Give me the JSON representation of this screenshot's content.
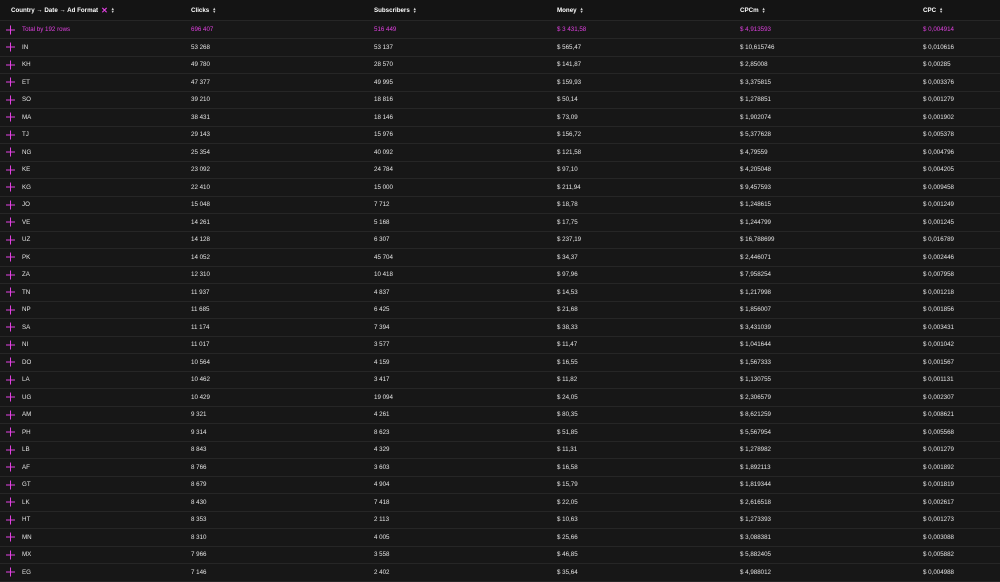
{
  "header": {
    "group_label": "Country → Date → Ad Format",
    "columns": [
      "Clicks",
      "Subscribers",
      "Money",
      "CPCm",
      "CPC"
    ]
  },
  "total": {
    "label": "Total by 192 rows",
    "clicks": "696 407",
    "subscribers": "516 449",
    "money": "$ 3 431,58",
    "cpcm": "$ 4,913593",
    "cpc": "$ 0,004914"
  },
  "rows": [
    [
      "IN",
      "53 268",
      "53 137",
      "$ 565,47",
      "$ 10,615746",
      "$ 0,010616"
    ],
    [
      "KH",
      "49 780",
      "28 570",
      "$ 141,87",
      "$ 2,85008",
      "$ 0,00285"
    ],
    [
      "ET",
      "47 377",
      "49 995",
      "$ 159,93",
      "$ 3,375815",
      "$ 0,003376"
    ],
    [
      "SO",
      "39 210",
      "18 816",
      "$ 50,14",
      "$ 1,278851",
      "$ 0,001279"
    ],
    [
      "MA",
      "38 431",
      "18 146",
      "$ 73,09",
      "$ 1,902074",
      "$ 0,001902"
    ],
    [
      "TJ",
      "29 143",
      "15 976",
      "$ 156,72",
      "$ 5,377628",
      "$ 0,005378"
    ],
    [
      "NG",
      "25 354",
      "40 092",
      "$ 121,58",
      "$ 4,79559",
      "$ 0,004796"
    ],
    [
      "KE",
      "23 092",
      "24 784",
      "$ 97,10",
      "$ 4,205048",
      "$ 0,004205"
    ],
    [
      "KG",
      "22 410",
      "15 000",
      "$ 211,94",
      "$ 9,457593",
      "$ 0,009458"
    ],
    [
      "JO",
      "15 048",
      "7 712",
      "$ 18,78",
      "$ 1,248615",
      "$ 0,001249"
    ],
    [
      "VE",
      "14 261",
      "5 168",
      "$ 17,75",
      "$ 1,244799",
      "$ 0,001245"
    ],
    [
      "UZ",
      "14 128",
      "6 307",
      "$ 237,19",
      "$ 16,788699",
      "$ 0,016789"
    ],
    [
      "PK",
      "14 052",
      "45 704",
      "$ 34,37",
      "$ 2,446071",
      "$ 0,002446"
    ],
    [
      "ZA",
      "12 310",
      "10 418",
      "$ 97,96",
      "$ 7,958254",
      "$ 0,007958"
    ],
    [
      "TN",
      "11 937",
      "4 837",
      "$ 14,53",
      "$ 1,217998",
      "$ 0,001218"
    ],
    [
      "NP",
      "11 685",
      "6 425",
      "$ 21,68",
      "$ 1,856007",
      "$ 0,001856"
    ],
    [
      "SA",
      "11 174",
      "7 394",
      "$ 38,33",
      "$ 3,431039",
      "$ 0,003431"
    ],
    [
      "NI",
      "11 017",
      "3 577",
      "$ 11,47",
      "$ 1,041644",
      "$ 0,001042"
    ],
    [
      "DO",
      "10 564",
      "4 159",
      "$ 16,55",
      "$ 1,567333",
      "$ 0,001567"
    ],
    [
      "LA",
      "10 462",
      "3 417",
      "$ 11,82",
      "$ 1,130755",
      "$ 0,001131"
    ],
    [
      "UG",
      "10 429",
      "19 094",
      "$ 24,05",
      "$ 2,306579",
      "$ 0,002307"
    ],
    [
      "AM",
      "9 321",
      "4 261",
      "$ 80,35",
      "$ 8,621259",
      "$ 0,008621"
    ],
    [
      "PH",
      "9 314",
      "8 623",
      "$ 51,85",
      "$ 5,567954",
      "$ 0,005568"
    ],
    [
      "LB",
      "8 843",
      "4 329",
      "$ 11,31",
      "$ 1,278982",
      "$ 0,001279"
    ],
    [
      "AF",
      "8 766",
      "3 603",
      "$ 16,58",
      "$ 1,892113",
      "$ 0,001892"
    ],
    [
      "GT",
      "8 679",
      "4 904",
      "$ 15,79",
      "$ 1,819344",
      "$ 0,001819"
    ],
    [
      "LK",
      "8 430",
      "7 418",
      "$ 22,05",
      "$ 2,616518",
      "$ 0,002617"
    ],
    [
      "HT",
      "8 353",
      "2 113",
      "$ 10,63",
      "$ 1,273393",
      "$ 0,001273"
    ],
    [
      "MN",
      "8 310",
      "4 005",
      "$ 25,66",
      "$ 3,088381",
      "$ 0,003088"
    ],
    [
      "MX",
      "7 966",
      "3 558",
      "$ 46,85",
      "$ 5,882405",
      "$ 0,005882"
    ],
    [
      "EG",
      "7 146",
      "2 402",
      "$ 35,64",
      "$ 4,988012",
      "$ 0,004988"
    ]
  ],
  "colors": {
    "accent": "#e040e0",
    "background": "#171717",
    "row_border": "#262626"
  },
  "icons": {
    "expand": "plus-icon",
    "sort": "sort-arrows-icon",
    "clear": "close-icon"
  }
}
